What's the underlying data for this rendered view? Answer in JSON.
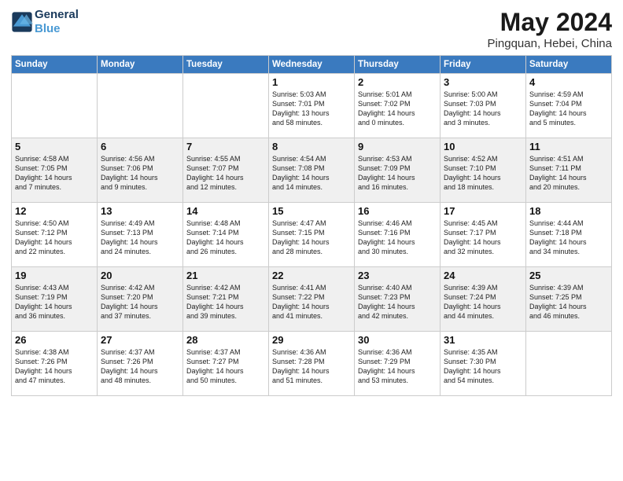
{
  "header": {
    "logo_line1": "General",
    "logo_line2": "Blue",
    "month": "May 2024",
    "location": "Pingquan, Hebei, China"
  },
  "weekdays": [
    "Sunday",
    "Monday",
    "Tuesday",
    "Wednesday",
    "Thursday",
    "Friday",
    "Saturday"
  ],
  "weeks": [
    [
      {
        "day": "",
        "lines": []
      },
      {
        "day": "",
        "lines": []
      },
      {
        "day": "",
        "lines": []
      },
      {
        "day": "1",
        "lines": [
          "Sunrise: 5:03 AM",
          "Sunset: 7:01 PM",
          "Daylight: 13 hours",
          "and 58 minutes."
        ]
      },
      {
        "day": "2",
        "lines": [
          "Sunrise: 5:01 AM",
          "Sunset: 7:02 PM",
          "Daylight: 14 hours",
          "and 0 minutes."
        ]
      },
      {
        "day": "3",
        "lines": [
          "Sunrise: 5:00 AM",
          "Sunset: 7:03 PM",
          "Daylight: 14 hours",
          "and 3 minutes."
        ]
      },
      {
        "day": "4",
        "lines": [
          "Sunrise: 4:59 AM",
          "Sunset: 7:04 PM",
          "Daylight: 14 hours",
          "and 5 minutes."
        ]
      }
    ],
    [
      {
        "day": "5",
        "lines": [
          "Sunrise: 4:58 AM",
          "Sunset: 7:05 PM",
          "Daylight: 14 hours",
          "and 7 minutes."
        ]
      },
      {
        "day": "6",
        "lines": [
          "Sunrise: 4:56 AM",
          "Sunset: 7:06 PM",
          "Daylight: 14 hours",
          "and 9 minutes."
        ]
      },
      {
        "day": "7",
        "lines": [
          "Sunrise: 4:55 AM",
          "Sunset: 7:07 PM",
          "Daylight: 14 hours",
          "and 12 minutes."
        ]
      },
      {
        "day": "8",
        "lines": [
          "Sunrise: 4:54 AM",
          "Sunset: 7:08 PM",
          "Daylight: 14 hours",
          "and 14 minutes."
        ]
      },
      {
        "day": "9",
        "lines": [
          "Sunrise: 4:53 AM",
          "Sunset: 7:09 PM",
          "Daylight: 14 hours",
          "and 16 minutes."
        ]
      },
      {
        "day": "10",
        "lines": [
          "Sunrise: 4:52 AM",
          "Sunset: 7:10 PM",
          "Daylight: 14 hours",
          "and 18 minutes."
        ]
      },
      {
        "day": "11",
        "lines": [
          "Sunrise: 4:51 AM",
          "Sunset: 7:11 PM",
          "Daylight: 14 hours",
          "and 20 minutes."
        ]
      }
    ],
    [
      {
        "day": "12",
        "lines": [
          "Sunrise: 4:50 AM",
          "Sunset: 7:12 PM",
          "Daylight: 14 hours",
          "and 22 minutes."
        ]
      },
      {
        "day": "13",
        "lines": [
          "Sunrise: 4:49 AM",
          "Sunset: 7:13 PM",
          "Daylight: 14 hours",
          "and 24 minutes."
        ]
      },
      {
        "day": "14",
        "lines": [
          "Sunrise: 4:48 AM",
          "Sunset: 7:14 PM",
          "Daylight: 14 hours",
          "and 26 minutes."
        ]
      },
      {
        "day": "15",
        "lines": [
          "Sunrise: 4:47 AM",
          "Sunset: 7:15 PM",
          "Daylight: 14 hours",
          "and 28 minutes."
        ]
      },
      {
        "day": "16",
        "lines": [
          "Sunrise: 4:46 AM",
          "Sunset: 7:16 PM",
          "Daylight: 14 hours",
          "and 30 minutes."
        ]
      },
      {
        "day": "17",
        "lines": [
          "Sunrise: 4:45 AM",
          "Sunset: 7:17 PM",
          "Daylight: 14 hours",
          "and 32 minutes."
        ]
      },
      {
        "day": "18",
        "lines": [
          "Sunrise: 4:44 AM",
          "Sunset: 7:18 PM",
          "Daylight: 14 hours",
          "and 34 minutes."
        ]
      }
    ],
    [
      {
        "day": "19",
        "lines": [
          "Sunrise: 4:43 AM",
          "Sunset: 7:19 PM",
          "Daylight: 14 hours",
          "and 36 minutes."
        ]
      },
      {
        "day": "20",
        "lines": [
          "Sunrise: 4:42 AM",
          "Sunset: 7:20 PM",
          "Daylight: 14 hours",
          "and 37 minutes."
        ]
      },
      {
        "day": "21",
        "lines": [
          "Sunrise: 4:42 AM",
          "Sunset: 7:21 PM",
          "Daylight: 14 hours",
          "and 39 minutes."
        ]
      },
      {
        "day": "22",
        "lines": [
          "Sunrise: 4:41 AM",
          "Sunset: 7:22 PM",
          "Daylight: 14 hours",
          "and 41 minutes."
        ]
      },
      {
        "day": "23",
        "lines": [
          "Sunrise: 4:40 AM",
          "Sunset: 7:23 PM",
          "Daylight: 14 hours",
          "and 42 minutes."
        ]
      },
      {
        "day": "24",
        "lines": [
          "Sunrise: 4:39 AM",
          "Sunset: 7:24 PM",
          "Daylight: 14 hours",
          "and 44 minutes."
        ]
      },
      {
        "day": "25",
        "lines": [
          "Sunrise: 4:39 AM",
          "Sunset: 7:25 PM",
          "Daylight: 14 hours",
          "and 46 minutes."
        ]
      }
    ],
    [
      {
        "day": "26",
        "lines": [
          "Sunrise: 4:38 AM",
          "Sunset: 7:26 PM",
          "Daylight: 14 hours",
          "and 47 minutes."
        ]
      },
      {
        "day": "27",
        "lines": [
          "Sunrise: 4:37 AM",
          "Sunset: 7:26 PM",
          "Daylight: 14 hours",
          "and 48 minutes."
        ]
      },
      {
        "day": "28",
        "lines": [
          "Sunrise: 4:37 AM",
          "Sunset: 7:27 PM",
          "Daylight: 14 hours",
          "and 50 minutes."
        ]
      },
      {
        "day": "29",
        "lines": [
          "Sunrise: 4:36 AM",
          "Sunset: 7:28 PM",
          "Daylight: 14 hours",
          "and 51 minutes."
        ]
      },
      {
        "day": "30",
        "lines": [
          "Sunrise: 4:36 AM",
          "Sunset: 7:29 PM",
          "Daylight: 14 hours",
          "and 53 minutes."
        ]
      },
      {
        "day": "31",
        "lines": [
          "Sunrise: 4:35 AM",
          "Sunset: 7:30 PM",
          "Daylight: 14 hours",
          "and 54 minutes."
        ]
      },
      {
        "day": "",
        "lines": []
      }
    ]
  ]
}
